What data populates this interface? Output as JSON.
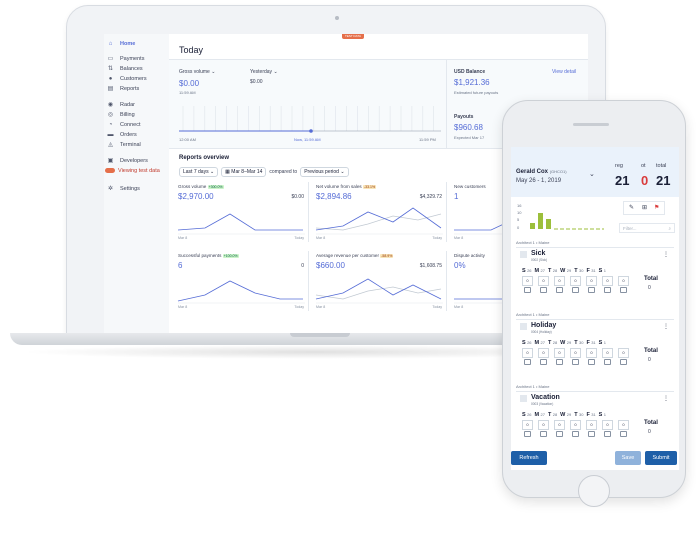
{
  "sidebar": {
    "home": "Home",
    "items": [
      "Payments",
      "Balances",
      "Customers",
      "Reports"
    ],
    "items2": [
      "Radar",
      "Billing",
      "Connect",
      "Orders",
      "Terminal"
    ],
    "developers": "Developers",
    "test_data": "Viewing test data",
    "settings": "Settings"
  },
  "badge": "TEST DATA",
  "today": {
    "title": "Today",
    "gross_label": "Gross volume",
    "gross_value": "$0.00",
    "gross_time": "11:59 AM",
    "yesterday_label": "Yesterday",
    "yesterday_value": "$0.00",
    "axis_start": "12:00 AM",
    "axis_now": "Now, 11:59 AM",
    "axis_end": "11:59 PM",
    "usd_label": "USD Balance",
    "usd_value": "$1,921.36",
    "usd_sub": "Estimated future payouts",
    "view_detail": "View detail",
    "payouts_label": "Payouts",
    "payouts_value": "$960.68",
    "payouts_sub": "Expected Mar 17"
  },
  "reports": {
    "title": "Reports overview",
    "range": "Last 7 days",
    "dates": "Mar 8–Mar 14",
    "compared": "compared to",
    "period": "Previous period",
    "cells": [
      {
        "title": "Gross volume",
        "badge": "+300.0%",
        "value": "$2,970.00",
        "right": "$0.00",
        "xl": "Mar 8",
        "xr": "Today",
        "badge_kind": "g"
      },
      {
        "title": "Net volume from sales",
        "badge": "-33.1%",
        "value": "$2,894.86",
        "right": "$4,329.72",
        "xl": "Mar 8",
        "xr": "Today",
        "badge_kind": "o"
      },
      {
        "title": "New customers",
        "badge": "",
        "value": "1",
        "right": "",
        "xl": "Mar 8",
        "xr": "",
        "badge_kind": ""
      },
      {
        "title": "Successful payments",
        "badge": "+100.0%",
        "value": "6",
        "right": "0",
        "xl": "Mar 8",
        "xr": "Today",
        "badge_kind": "g"
      },
      {
        "title": "Average revenue per customer",
        "badge": "-58.9%",
        "value": "$660.00",
        "right": "$1,608.75",
        "xl": "Mar 8",
        "xr": "Today",
        "badge_kind": "o"
      },
      {
        "title": "Dispute activity",
        "badge": "",
        "value": "0%",
        "right": "",
        "xl": "Mar 8",
        "xr": "",
        "badge_kind": ""
      }
    ]
  },
  "phone": {
    "name": "Gerald Cox",
    "name_code": "(GHCO1)",
    "date": "May 26 - 1, 2019",
    "reg_label": "reg",
    "reg_value": "21",
    "ot_label": "ot",
    "ot_value": "0",
    "total_label": "total",
    "total_value": "21",
    "filter_placeholder": "Filter...",
    "chart_ticks": [
      "16",
      "10",
      "5",
      "0"
    ],
    "sections": [
      {
        "project": "Architect 1 • Maine",
        "title": "Sick",
        "code": "0002 (Sick)"
      },
      {
        "project": "Architect 1 • Maine",
        "title": "Holiday",
        "code": "0004 (Holiday)"
      },
      {
        "project": "Architect 1 • Maine",
        "title": "Vacation",
        "code": "0003 (Vacation)"
      }
    ],
    "days": [
      {
        "d": "S",
        "n": "26"
      },
      {
        "d": "M",
        "n": "27"
      },
      {
        "d": "T",
        "n": "28"
      },
      {
        "d": "W",
        "n": "29"
      },
      {
        "d": "T",
        "n": "30"
      },
      {
        "d": "F",
        "n": "31"
      },
      {
        "d": "S",
        "n": "1"
      }
    ],
    "box_value": "0",
    "row_total_label": "Total",
    "row_total_value": "0",
    "refresh": "Refresh",
    "save": "Save",
    "submit": "Submit"
  }
}
